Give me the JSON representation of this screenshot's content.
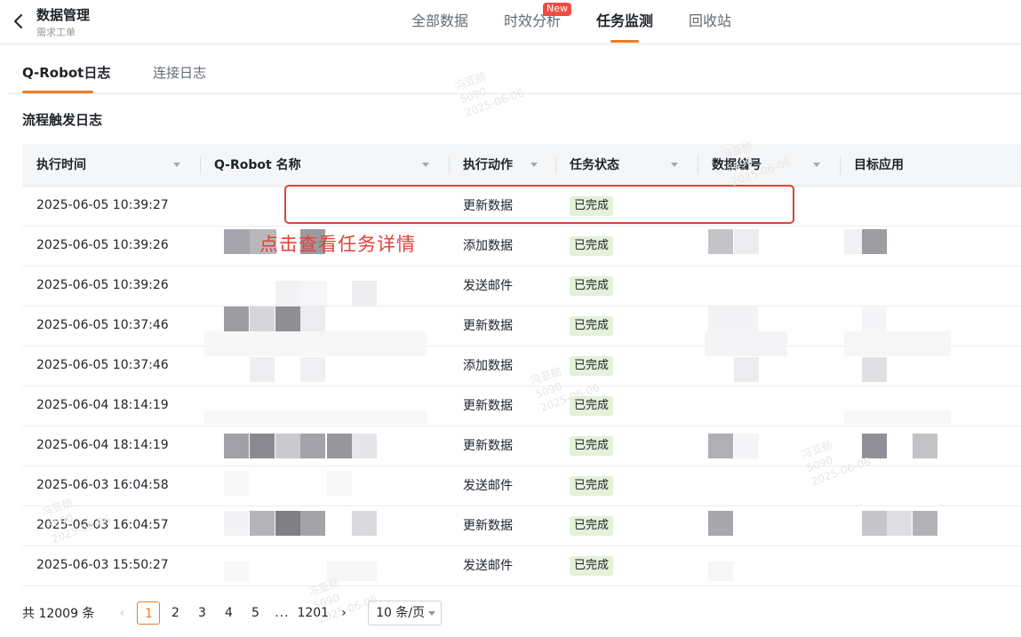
{
  "header": {
    "title": "数据管理",
    "subtitle": "需求工单",
    "tabs": [
      {
        "label": "全部数据",
        "active": false
      },
      {
        "label": "时效分析",
        "active": false,
        "badge": "New"
      },
      {
        "label": "任务监测",
        "active": true
      },
      {
        "label": "回收站",
        "active": false
      }
    ]
  },
  "subtabs": [
    {
      "label": "Q-Robot日志",
      "active": true
    },
    {
      "label": "连接日志",
      "active": false
    }
  ],
  "section_title": "流程触发日志",
  "table": {
    "columns": [
      "执行时间",
      "Q-Robot 名称",
      "执行动作",
      "任务状态",
      "数据编号",
      "目标应用"
    ],
    "rows": [
      {
        "time": "2025-06-05 10:39:27",
        "action": "更新数据",
        "status": "已完成"
      },
      {
        "time": "2025-06-05 10:39:26",
        "action": "添加数据",
        "status": "已完成"
      },
      {
        "time": "2025-06-05 10:39:26",
        "action": "发送邮件",
        "status": "已完成"
      },
      {
        "time": "2025-06-05 10:37:46",
        "action": "更新数据",
        "status": "已完成"
      },
      {
        "time": "2025-06-05 10:37:46",
        "action": "添加数据",
        "status": "已完成"
      },
      {
        "time": "2025-06-04 18:14:19",
        "action": "更新数据",
        "status": "已完成"
      },
      {
        "time": "2025-06-04 18:14:19",
        "action": "更新数据",
        "status": "已完成"
      },
      {
        "time": "2025-06-03 16:04:58",
        "action": "发送邮件",
        "status": "已完成"
      },
      {
        "time": "2025-06-03 16:04:57",
        "action": "更新数据",
        "status": "已完成"
      },
      {
        "time": "2025-06-03 15:50:27",
        "action": "发送邮件",
        "status": "已完成"
      }
    ]
  },
  "annotation": "点击查看任务详情",
  "watermark": {
    "name": "冯亚舫",
    "id": "5090",
    "date": "2025-06-06"
  },
  "pagination": {
    "total": "共 12009 条",
    "pages": [
      "1",
      "2",
      "3",
      "4",
      "5",
      "...",
      "1201"
    ],
    "current": "1",
    "page_size": "10 条/页"
  },
  "colors": {
    "accent": "#f07a20",
    "annotation": "#d9453a",
    "status_bg": "#e3f2d8",
    "new_badge": "#f24b3f"
  }
}
